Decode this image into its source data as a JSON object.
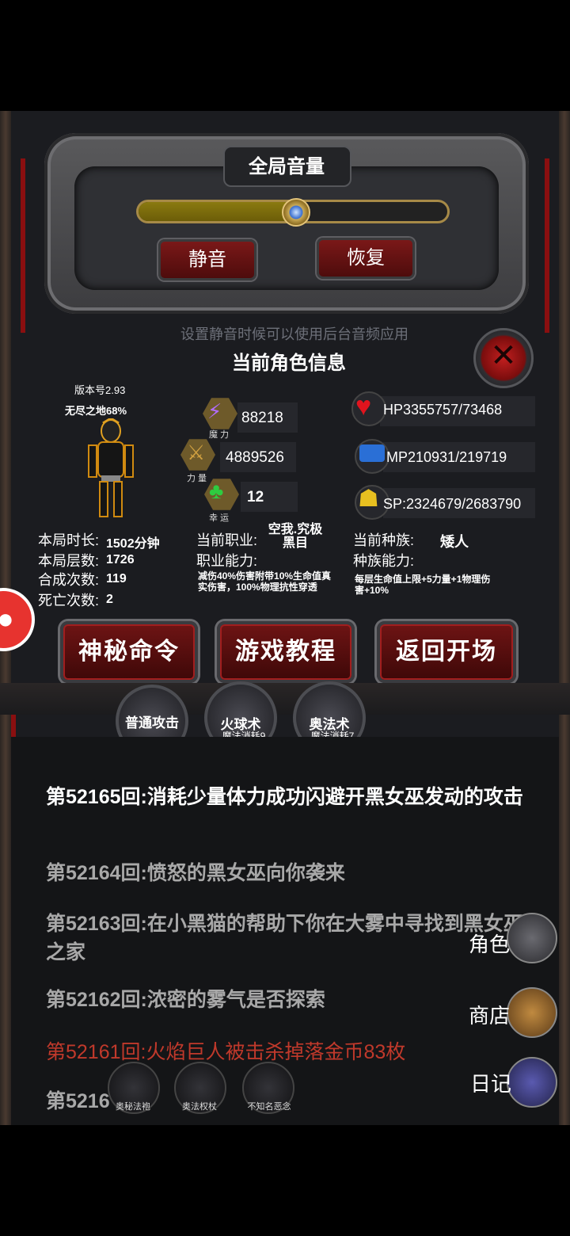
{
  "volume": {
    "title": "全局音量",
    "level_percent": 51,
    "mute_label": "静音",
    "restore_label": "恢复",
    "note": "设置静音时候可以使用后台音频应用"
  },
  "character": {
    "title": "当前角色信息",
    "version": "版本号2.93",
    "stage": "无尽之地68%",
    "magic": {
      "value": "88218",
      "label": "魔 力"
    },
    "strength": {
      "value": "4889526",
      "label": "力 量"
    },
    "luck": {
      "value": "12",
      "label": "幸 运"
    },
    "hp": "HP3355757/73468",
    "mp": "MP210931/219719",
    "sp": "SP:2324679/2683790",
    "stats": {
      "duration_label": "本局时长:",
      "duration_value": "1502分钟",
      "floors_label": "本局层数:",
      "floors_value": "1726",
      "crafts_label": "合成次数:",
      "crafts_value": "119",
      "deaths_label": "死亡次数:",
      "deaths_value": "2"
    },
    "job_label": "当前职业:",
    "job_value": "空我.究极\n黑目",
    "job_ability_label": "职业能力:",
    "job_ability_desc": "减伤40%伤害附带10%生命值真实伤害，100%物理抗性穿透",
    "race_label": "当前种族:",
    "race_value": "矮人",
    "race_ability_label": "种族能力:",
    "race_ability_desc": "每层生命值上限+5力量+1物理伤害+10%"
  },
  "buttons": {
    "secret": "神秘命令",
    "tutorial": "游戏教程",
    "back": "返回开场"
  },
  "skills": [
    {
      "name": "普通攻击",
      "cost": ""
    },
    {
      "name": "火球术",
      "cost": "魔法消耗9"
    },
    {
      "name": "奥法术",
      "cost": "魔法消耗7"
    }
  ],
  "log": [
    {
      "text": "第52165回:消耗少量体力成功闪避开黑女巫发动的攻击",
      "color": "#ffffff"
    },
    {
      "text": "第52164回:愤怒的黑女巫向你袭来",
      "color": "#a8a8a8"
    },
    {
      "text": "第52163回:在小黑猫的帮助下你在大雾中寻找到黑女巫之家",
      "color": "#a8a8a8"
    },
    {
      "text": "第52162回:浓密的雾气是否探索",
      "color": "#a8a8a8"
    },
    {
      "text": "第52161回:火焰巨人被击杀掉落金币83枚",
      "color": "#c0392b"
    },
    {
      "text": "第5216",
      "color": "#a8a8a8"
    }
  ],
  "side_menu": {
    "role": "角色",
    "shop": "商店",
    "diary": "日记"
  },
  "items": [
    {
      "label": "奥秘法袍"
    },
    {
      "label": "奥法权杖"
    },
    {
      "label": "不知名恶念"
    }
  ],
  "colors": {
    "frame_red": "#8a0f10",
    "button_red": "#6e1414",
    "log_red": "#c0392b",
    "slider_gold": "#a78a47"
  }
}
